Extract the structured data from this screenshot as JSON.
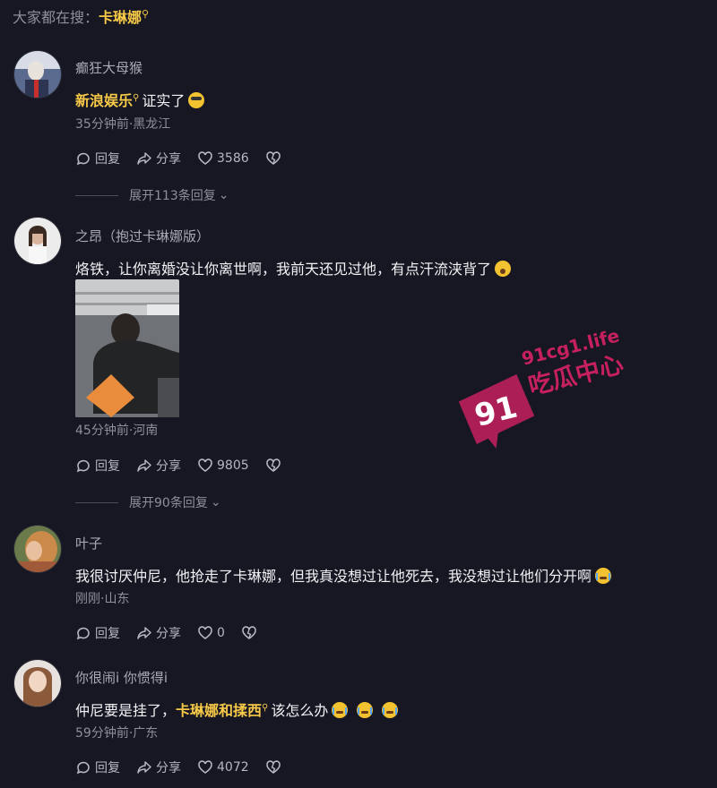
{
  "search_hint": {
    "prefix": "大家都在搜：",
    "keyword": "卡琳娜"
  },
  "comments": [
    {
      "author": "癫狂大母猴",
      "link_text": "新浪娱乐",
      "text_after": "证实了",
      "meta": "35分钟前·黑龙江",
      "reply_label": "回复",
      "share_label": "分享",
      "likes": "3586",
      "expand": "展开113条回复"
    },
    {
      "author": "之昂（抱过卡琳娜版）",
      "text": "烙铁，让你离婚没让你离世啊，我前天还见过他，有点汗流浃背了",
      "meta": "45分钟前·河南",
      "reply_label": "回复",
      "share_label": "分享",
      "likes": "9805",
      "expand": "展开90条回复"
    },
    {
      "author": "叶子",
      "text": "我很讨厌仲尼，他抢走了卡琳娜，但我真没想过让他死去，我没想过让他们分开啊",
      "meta": "刚刚·山东",
      "reply_label": "回复",
      "share_label": "分享",
      "likes": "0"
    },
    {
      "author": "你很闹i 你惯得i",
      "text_before": "仲尼要是挂了，",
      "link_text": "卡琳娜和揉西",
      "text_after": "该怎么办",
      "meta": "59分钟前·广东",
      "reply_label": "回复",
      "share_label": "分享",
      "likes": "4072"
    }
  ],
  "watermark": {
    "number": "91",
    "site": "91cg1.life",
    "name": "吃瓜中心"
  },
  "colors": {
    "background": "#161722",
    "accent": "#f7c948",
    "watermark": "#c7205f"
  },
  "icons": [
    "search-icon",
    "comment-icon",
    "share-icon",
    "heart-icon",
    "dislike-heart-icon",
    "chevron-down-icon"
  ]
}
